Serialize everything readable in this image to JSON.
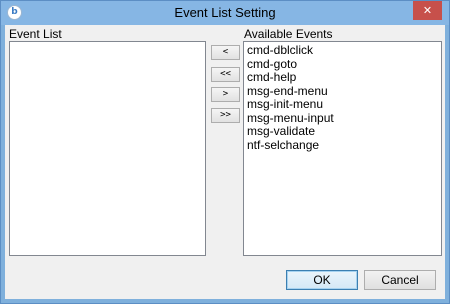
{
  "window": {
    "title": "Event List Setting",
    "app_icon_glyph": "b",
    "close_glyph": "✕",
    "accent_color": "#86b6e4",
    "close_color": "#c7504b"
  },
  "event_list": {
    "label": "Event List",
    "items": []
  },
  "available_events": {
    "label": "Available Events",
    "items": [
      "cmd-dblclick",
      "cmd-goto",
      "cmd-help",
      "msg-end-menu",
      "msg-init-menu",
      "msg-menu-input",
      "msg-validate",
      "ntf-selchange"
    ]
  },
  "move_buttons": {
    "add_one": "<",
    "add_all": "<<",
    "remove_one": ">",
    "remove_all": ">>"
  },
  "dialog_buttons": {
    "ok": "OK",
    "cancel": "Cancel"
  }
}
